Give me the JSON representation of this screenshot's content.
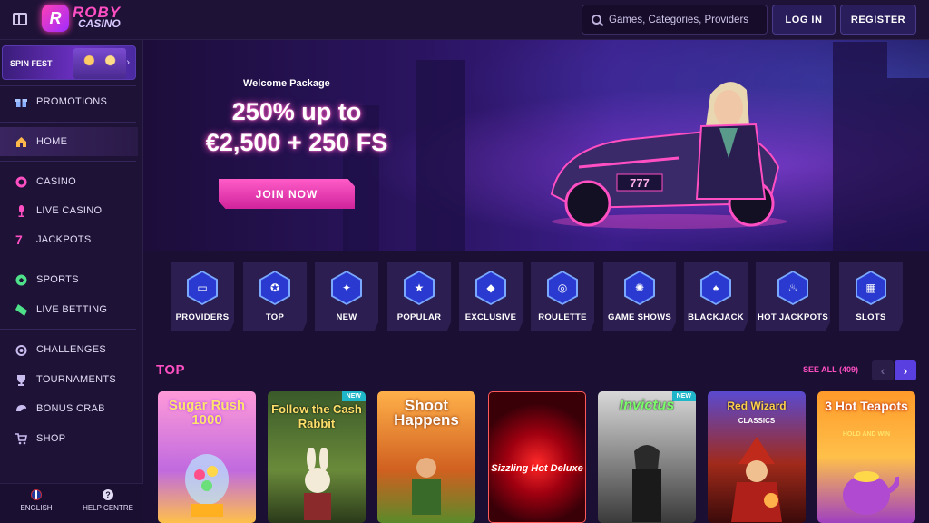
{
  "header": {
    "logo_line1": "ROBY",
    "logo_line2": "CASINO",
    "logo_mark": "R",
    "search_placeholder": "Games, Categories, Providers",
    "login_label": "LOG IN",
    "register_label": "REGISTER"
  },
  "sidebar": {
    "promo_banner": "SPIN FEST",
    "items": [
      {
        "label": "PROMOTIONS",
        "icon": "gift-icon"
      },
      {
        "label": "HOME",
        "icon": "home-icon",
        "active": true
      },
      {
        "label": "CASINO",
        "icon": "casino-chip-icon"
      },
      {
        "label": "LIVE CASINO",
        "icon": "microphone-icon"
      },
      {
        "label": "JACKPOTS",
        "icon": "seven-icon"
      },
      {
        "label": "SPORTS",
        "icon": "football-icon"
      },
      {
        "label": "LIVE BETTING",
        "icon": "ticket-icon"
      },
      {
        "label": "CHALLENGES",
        "icon": "medal-icon"
      },
      {
        "label": "TOURNAMENTS",
        "icon": "trophy-icon"
      },
      {
        "label": "BONUS CRAB",
        "icon": "crab-icon"
      },
      {
        "label": "SHOP",
        "icon": "cart-icon"
      }
    ],
    "footer": {
      "language": "ENGLISH",
      "help": "HELP CENTRE"
    }
  },
  "hero": {
    "subtitle": "Welcome Package",
    "title_line1": "250% up to",
    "title_line2": "€2,500 + 250 FS",
    "cta": "JOIN NOW",
    "bike_plate": "777"
  },
  "categories": [
    {
      "label": "PROVIDERS",
      "icon": "folder-icon"
    },
    {
      "label": "TOP",
      "icon": "badge-icon"
    },
    {
      "label": "NEW",
      "icon": "sparkle-icon"
    },
    {
      "label": "POPULAR",
      "icon": "star-icon"
    },
    {
      "label": "EXCLUSIVE",
      "icon": "diamond-icon"
    },
    {
      "label": "ROULETTE",
      "icon": "roulette-icon"
    },
    {
      "label": "GAME SHOWS",
      "icon": "wheel-icon"
    },
    {
      "label": "BLACKJACK",
      "icon": "spade-icon"
    },
    {
      "label": "HOT JACKPOTS",
      "icon": "flame-icon"
    },
    {
      "label": "SLOTS",
      "icon": "slot-machine-icon"
    }
  ],
  "top_section": {
    "title": "TOP",
    "see_all": "SEE ALL (409)",
    "games": [
      {
        "title": "Sugar Rush 1000",
        "new": false
      },
      {
        "title": "Follow the Cash Rabbit",
        "new": true,
        "badge": "NEW"
      },
      {
        "title": "Shoot Happens",
        "new": false
      },
      {
        "title": "Sizzling Hot Deluxe",
        "new": false
      },
      {
        "title": "Invictus",
        "new": true,
        "badge": "NEW"
      },
      {
        "title": "Red Wizard",
        "sub": "CLASSICS",
        "new": false
      },
      {
        "title": "3 Hot Teapots",
        "sub": "HOLD AND WIN",
        "new": false
      }
    ]
  },
  "colors": {
    "accent": "#ff4fc3",
    "primary_bg": "#1b1033",
    "button": "#2a1d5c"
  }
}
